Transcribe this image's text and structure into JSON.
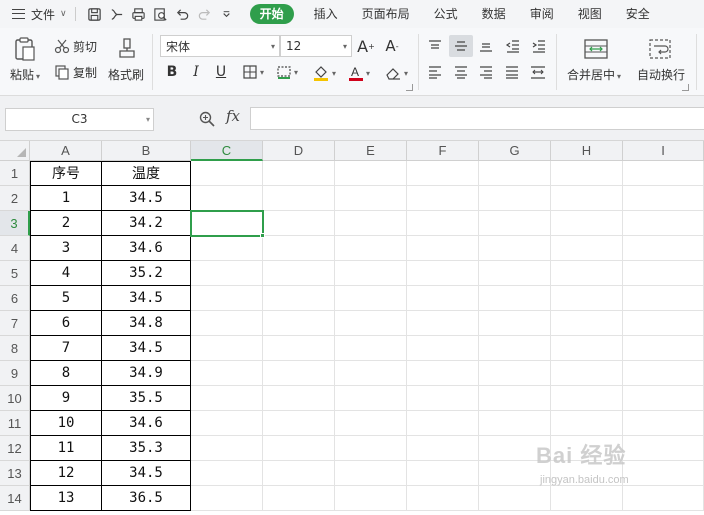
{
  "menubar": {
    "file_label": "文件",
    "tabs": [
      "开始",
      "插入",
      "页面布局",
      "公式",
      "数据",
      "审阅",
      "视图",
      "安全"
    ],
    "active_tab": "开始"
  },
  "ribbon": {
    "paste": "粘贴",
    "cut": "剪切",
    "copy": "复制",
    "format_painter": "格式刷",
    "font_name": "宋体",
    "font_size": "12",
    "merge_center": "合并居中",
    "wrap_text": "自动换行",
    "font_color": "#d0021b",
    "fill_color": "#f5c400"
  },
  "formula_bar": {
    "name_box": "C3",
    "fx": "fx",
    "formula": ""
  },
  "sheet": {
    "columns": [
      "A",
      "B",
      "C",
      "D",
      "E",
      "F",
      "G",
      "H",
      "I"
    ],
    "selected_column": "C",
    "rows": [
      "1",
      "2",
      "3",
      "4",
      "5",
      "6",
      "7",
      "8",
      "9",
      "10",
      "11",
      "12",
      "13",
      "14"
    ],
    "selected_row": "3",
    "header": [
      "序号",
      "温度"
    ],
    "data": [
      [
        "1",
        "34.5"
      ],
      [
        "2",
        "34.2"
      ],
      [
        "3",
        "34.6"
      ],
      [
        "4",
        "35.2"
      ],
      [
        "5",
        "34.5"
      ],
      [
        "6",
        "34.8"
      ],
      [
        "7",
        "34.5"
      ],
      [
        "8",
        "34.9"
      ],
      [
        "9",
        "35.5"
      ],
      [
        "10",
        "34.6"
      ],
      [
        "11",
        "35.3"
      ],
      [
        "12",
        "34.5"
      ],
      [
        "13",
        "36.5"
      ]
    ],
    "accent": "#2f9e4b"
  },
  "watermark": {
    "text": "Bai 经验",
    "url": "jingyan.baidu.com"
  }
}
